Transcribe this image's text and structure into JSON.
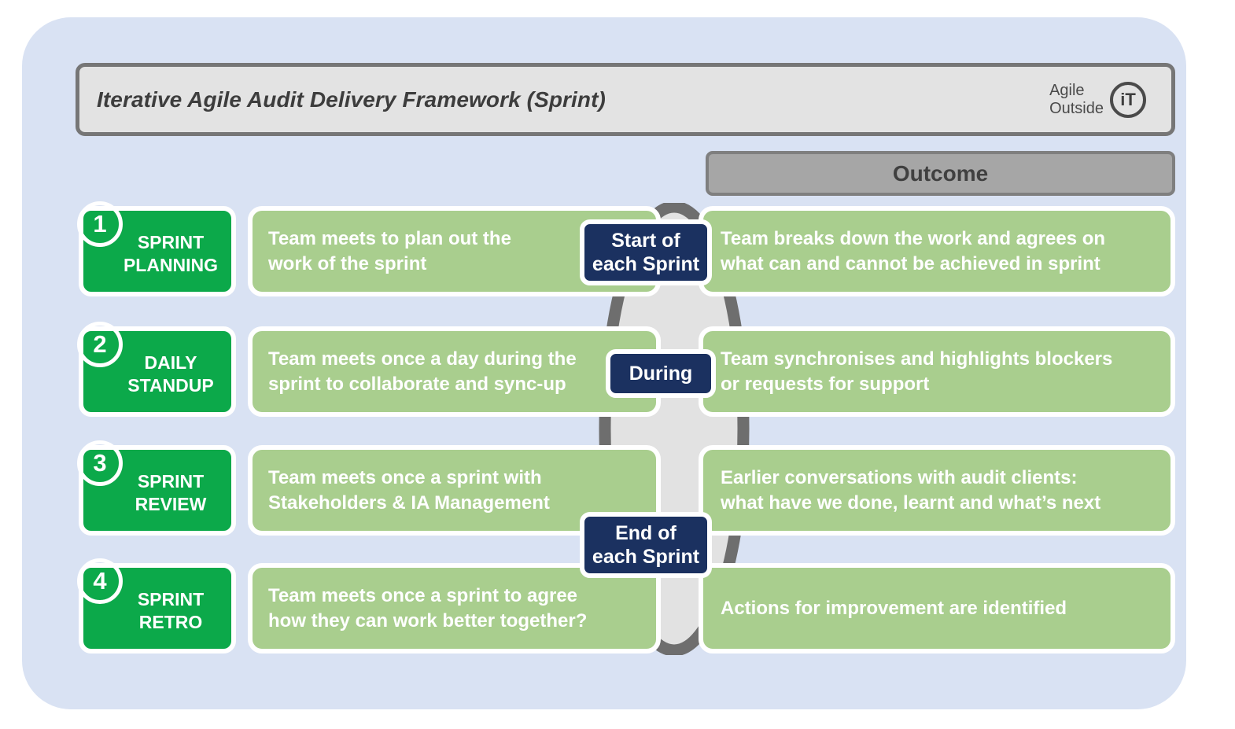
{
  "header": {
    "title": "Iterative Agile Audit Delivery Framework (Sprint)",
    "logo": {
      "line1": "Agile",
      "line2": "Outside",
      "mark": "iT"
    }
  },
  "columns": {
    "outcome_header": "Outcome"
  },
  "colors": {
    "panel_background": "#d9e2f3",
    "title_fill": "#e3e3e3",
    "title_border": "#767676",
    "outcome_header_fill": "#a6a6a6",
    "outcome_header_border": "#7f7f7f",
    "stage_green": "#0ca94a",
    "box_green": "#a9ce8e",
    "marker_navy": "#1b3160",
    "ring_fill": "#e2e2e2",
    "ring_stroke": "#6e6e6e"
  },
  "rows": [
    {
      "number": "1",
      "stage_line1": "SPRINT",
      "stage_line2": "PLANNING",
      "activity_line1": "Team meets to plan out the",
      "activity_line2": "work of the sprint",
      "outcome_line1": "Team breaks down the work and agrees on",
      "outcome_line2": "what can and cannot be achieved in sprint"
    },
    {
      "number": "2",
      "stage_line1": "DAILY",
      "stage_line2": "STANDUP",
      "activity_line1": "Team meets once a day during the",
      "activity_line2": "sprint to collaborate and sync-up",
      "outcome_line1": "Team synchronises and highlights blockers",
      "outcome_line2": "or requests for support"
    },
    {
      "number": "3",
      "stage_line1": "SPRINT",
      "stage_line2": "REVIEW",
      "activity_line1": "Team meets once a sprint with",
      "activity_line2": "Stakeholders & IA Management",
      "outcome_line1": "Earlier conversations with audit clients:",
      "outcome_line2": "what have we done, learnt and what’s next"
    },
    {
      "number": "4",
      "stage_line1": "SPRINT",
      "stage_line2": "RETRO",
      "activity_line1": "Team meets once a sprint to agree",
      "activity_line2": "how they can work better together?",
      "outcome_line1": "Actions for improvement are identified",
      "outcome_line2": ""
    }
  ],
  "timing_markers": [
    {
      "line1": "Start of",
      "line2": "each Sprint"
    },
    {
      "line1": "During",
      "line2": ""
    },
    {
      "line1": "End of",
      "line2": "each Sprint"
    }
  ]
}
